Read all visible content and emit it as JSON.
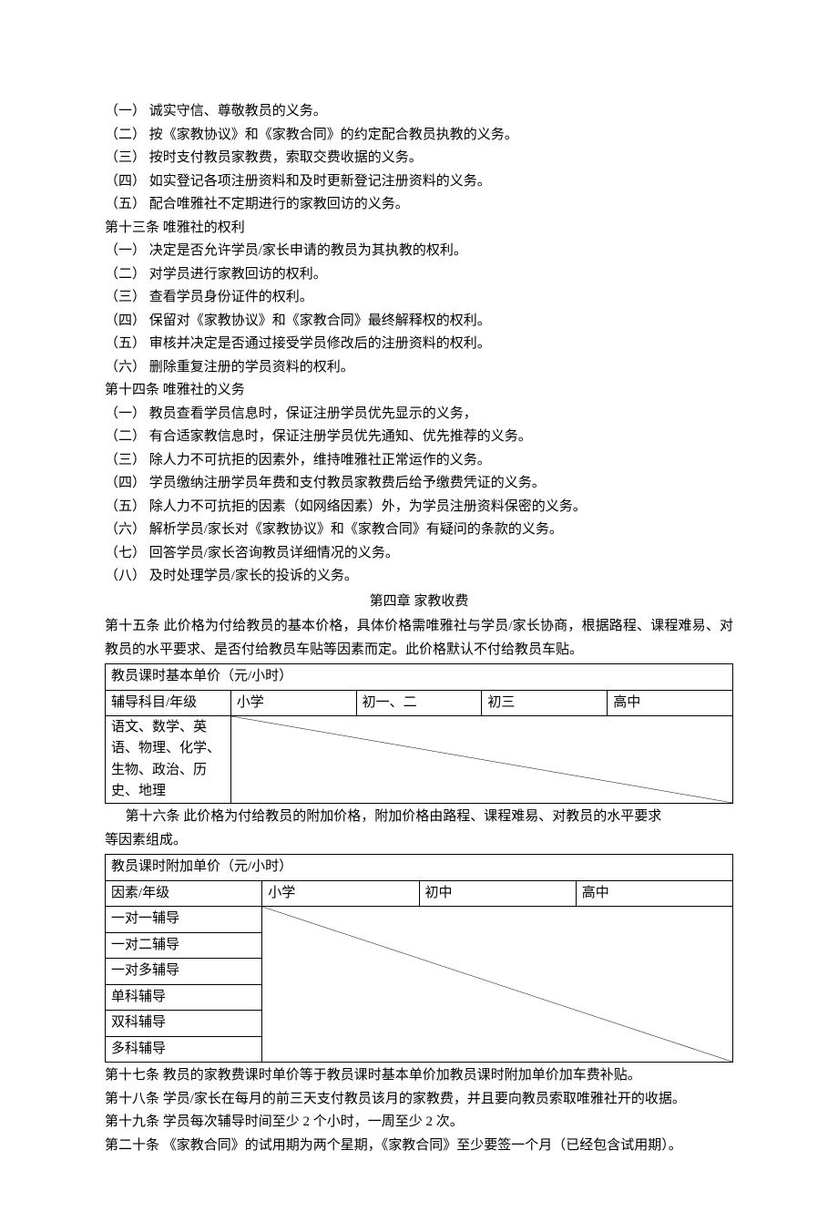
{
  "lines_before_chapter": [
    "（一） 诚实守信、尊敬教员的义务。",
    "（二） 按《家教协议》和《家教合同》的约定配合教员执教的义务。",
    "（三） 按时支付教员家教费，索取交费收据的义务。",
    "（四） 如实登记各项注册资料和及时更新登记注册资料的义务。",
    "（五） 配合唯雅社不定期进行的家教回访的义务。",
    "第十三条 唯雅社的权利",
    "（一） 决定是否允许学员/家长申请的教员为其执教的权利。",
    "（二） 对学员进行家教回访的权利。",
    "（三） 查看学员身份证件的权利。",
    "（四） 保留对《家教协议》和《家教合同》最终解释权的权利。",
    "（五） 审核并决定是否通过接受学员修改后的注册资料的权利。",
    "（六） 删除重复注册的学员资料的权利。",
    "第十四条 唯雅社的义务",
    "（一） 教员查看学员信息时，保证注册学员优先显示的义务，",
    "（二） 有合适家教信息时，保证注册学员优先通知、优先推荐的义务。",
    "（三） 除人力不可抗拒的因素外，维持唯雅社正常运作的义务。",
    "（四） 学员缴纳注册学员年费和支付教员家教费后给予缴费凭证的义务。",
    "（五） 除人力不可抗拒的因素（如网络因素）外，为学员注册资料保密的义务。",
    "（六） 解析学员/家长对《家教协议》和《家教合同》有疑问的条款的义务。",
    "（七） 回答学员/家长咨询教员详细情况的义务。",
    "（八） 及时处理学员/家长的投诉的义务。"
  ],
  "chapter_title": "第四章  家教收费",
  "article15": "第十五条 此价格为付给教员的基本价格，具体价格需唯雅社与学员/家长协商，根据路程、课程难易、对教员的水平要求、是否付给教员车贴等因素而定。此价格默认不付给教员车贴。",
  "table1": {
    "title": "教员课时基本单价（元/小时）",
    "header": [
      "辅导科目/年级",
      "小学",
      "初一、二",
      "初三",
      "高中"
    ],
    "row_label": "语文、数学、英语、物理、化学、生物、政治、历史、地理"
  },
  "article16_indent": "第十六条 此价格为付给教员的附加价格，附加价格由路程、课程难易、对教员的水平要求",
  "article16_rest": "等因素组成。",
  "table2": {
    "title": "教员课时附加单价（元/小时）",
    "header": [
      "因素/年级",
      "小学",
      "初中",
      "高中"
    ],
    "rows": [
      "一对一辅导",
      "一对二辅导",
      "一对多辅导",
      "单科辅导",
      "双科辅导",
      "多科辅导"
    ]
  },
  "lines_after": [
    "第十七条 教员的家教费课时单价等于教员课时基本单价加教员课时附加单价加车费补贴。",
    "第十八条 学员/家长在每月的前三天支付教员该月的家教费，并且要向教员索取唯雅社开的收据。",
    "第十九条   学员每次辅导时间至少 2 个小时，一周至少 2 次。",
    "第二十条   《家教合同》的试用期为两个星期，《家教合同》至少要签一个月（已经包含试用期）。"
  ]
}
